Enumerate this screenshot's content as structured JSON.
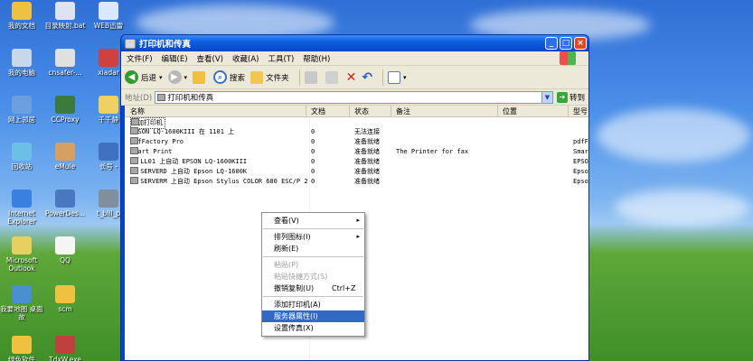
{
  "desktop": {
    "icons": [
      {
        "label": "我的文档",
        "color": "#f0c040"
      },
      {
        "label": "目录映射.bat",
        "color": "#dde3f0"
      },
      {
        "label": "WEB迅雷",
        "color": "#d9e8ff"
      },
      {
        "label": "我的电脑",
        "color": "#c9d7ea"
      },
      {
        "label": "cnsafer-...",
        "color": "#e0e0e0"
      },
      {
        "label": "xiadar",
        "color": "#d04040"
      },
      {
        "label": "网上邻居",
        "color": "#6aa0e0"
      },
      {
        "label": "CCProxy",
        "color": "#3a7a3a"
      },
      {
        "label": "千千静",
        "color": "#f0d060"
      },
      {
        "label": "回收站",
        "color": "#6cc0e8"
      },
      {
        "label": "eMule",
        "color": "#d8a060"
      },
      {
        "label": "长号 -",
        "color": "#4070c0"
      },
      {
        "label": "Internet Explorer",
        "color": "#3a80e0"
      },
      {
        "label": "PowerDes...",
        "color": "#4a78c0"
      },
      {
        "label": "t_bill_p",
        "color": "#7f8fa0"
      },
      {
        "label": "Microsoft Outlook",
        "color": "#e8d060"
      },
      {
        "label": "QQ",
        "color": "#f5f5f5"
      },
      {
        "label": "我要地图 桌面故",
        "color": "#4a90d0"
      },
      {
        "label": "scm",
        "color": "#f0c040"
      },
      {
        "label": "绿色软件",
        "color": "#f0c040"
      },
      {
        "label": "TdxW.exe",
        "color": "#c04040"
      }
    ]
  },
  "window": {
    "title": "打印机和传真",
    "buttons": {
      "minimize": "_",
      "maximize": "□",
      "close": "×"
    },
    "menu": [
      "文件(F)",
      "编辑(E)",
      "查看(V)",
      "收藏(A)",
      "工具(T)",
      "帮助(H)"
    ],
    "toolbar": {
      "back": "后退",
      "search": "搜索",
      "folders": "文件夹"
    },
    "address": {
      "label": "地址(D)",
      "value": "打印机和传真",
      "go": "转到"
    },
    "columns": [
      "名称",
      "文档",
      "状态",
      "备注",
      "位置",
      "型号"
    ],
    "rows": [
      {
        "name": "添加打印机",
        "docs": "",
        "status": "",
        "note": "",
        "loc": "",
        "model": ""
      },
      {
        "name": "EPSON LQ-1600KIII 在 1101 上",
        "docs": "0",
        "status": "无法连接",
        "note": "",
        "loc": "",
        "model": ""
      },
      {
        "name": "pdfFactory Pro",
        "docs": "0",
        "status": "准备就绪",
        "note": "",
        "loc": "",
        "model": "pdfF"
      },
      {
        "name": "Smart Print",
        "docs": "0",
        "status": "准备就绪",
        "note": "The Printer for fax",
        "loc": "",
        "model": "Smar"
      },
      {
        "name": "在 LL01 上自动 EPSON LQ-1600KIII",
        "docs": "0",
        "status": "准备就绪",
        "note": "",
        "loc": "",
        "model": "EPSO"
      },
      {
        "name": "在 SERVERD 上自动 Epson LQ-1600K",
        "docs": "0",
        "status": "准备就绪",
        "note": "",
        "loc": "",
        "model": "Epso"
      },
      {
        "name": "在 SERVERM 上自动 Epson Stylus COLOR 680 ESC/P 2",
        "docs": "0",
        "status": "准备就绪",
        "note": "",
        "loc": "",
        "model": "Epso"
      }
    ]
  },
  "context_menu": {
    "items": [
      {
        "label": "查看(V)",
        "arrow": "▸"
      },
      {
        "label": "排列图标(I)",
        "arrow": "▸"
      },
      {
        "label": "刷新(E)"
      },
      {
        "label": "粘贴(P)"
      },
      {
        "label": "粘贴快捷方式(S)"
      },
      {
        "label": "撤销复制(U)",
        "shortcut": "Ctrl+Z"
      },
      {
        "label": "添加打印机(A)"
      },
      {
        "label": "服务器属性(I)"
      },
      {
        "label": "设置传真(X)"
      }
    ]
  },
  "colors": {
    "title_blue": "#0a5fe0",
    "menu_bg": "#ece9d8",
    "highlight": "#316ac5"
  }
}
